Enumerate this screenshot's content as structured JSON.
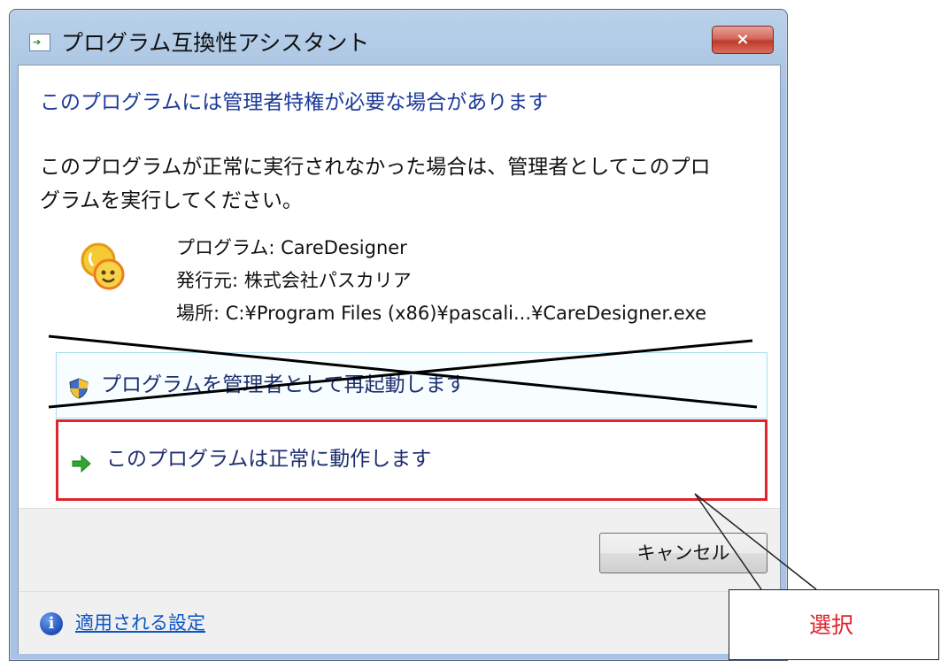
{
  "window": {
    "title": "プログラム互換性アシスタント",
    "close_label": "×"
  },
  "dialog": {
    "main_instruction": "このプログラムには管理者特権が必要な場合があります",
    "body_lines": [
      "このプログラムが正常に実行されなかった場合は、管理者としてこのプロ",
      "グラムを実行してください。"
    ],
    "program_info": {
      "program": "プログラム: CareDesigner",
      "publisher": "発行元: 株式会社パスカリア",
      "location": "場所: C:¥Program Files (x86)¥pascali...¥CareDesigner.exe"
    },
    "options": [
      {
        "label": "プログラムを管理者として再起動します",
        "icon": "uac-shield-icon"
      },
      {
        "label": "このプログラムは正常に動作します",
        "icon": "green-arrow-icon"
      }
    ],
    "cancel_label": "キャンセル",
    "settings_link": "適用される設定",
    "info_glyph": "i"
  },
  "annotation": {
    "callout_text": "選択",
    "highlight_color": "#e0242b"
  }
}
